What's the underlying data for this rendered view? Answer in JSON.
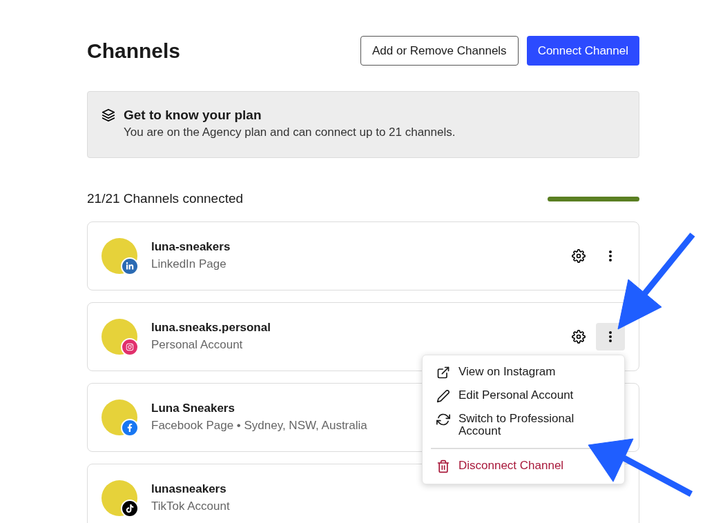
{
  "header": {
    "title": "Channels",
    "buttons": [
      {
        "label": "Add or Remove Channels",
        "kind": "outline"
      },
      {
        "label": "Connect Channel",
        "kind": "primary"
      }
    ]
  },
  "plan": {
    "title": "Get to know your plan",
    "text": "You are on the Agency plan and can connect up to 21 channels."
  },
  "usage": {
    "label": "21/21 Channels connected",
    "level": 1
  },
  "channels": [
    {
      "name": "luna-sneakers",
      "subtitle": "LinkedIn Page",
      "kind": "linkedin",
      "actions_visible": true
    },
    {
      "name": "luna.sneaks.personal",
      "subtitle": "Personal Account",
      "kind": "instagram",
      "actions_visible": true,
      "menu": {
        "items": [
          {
            "label": "View on Instagram",
            "kind": "external"
          },
          {
            "label": "Edit Personal Account",
            "kind": "edit"
          },
          {
            "label": "Switch to Professional Account",
            "kind": "switch"
          },
          {
            "label": "Disconnect Channel",
            "kind": "danger"
          }
        ]
      }
    },
    {
      "name": "Luna Sneakers",
      "subtitle": "Facebook Page • Sydney, NSW, Australia",
      "kind": "facebook",
      "actions_visible": false
    },
    {
      "name": "lunasneakers",
      "subtitle": "TikTok Account",
      "kind": "tiktok",
      "actions_visible": false
    }
  ]
}
